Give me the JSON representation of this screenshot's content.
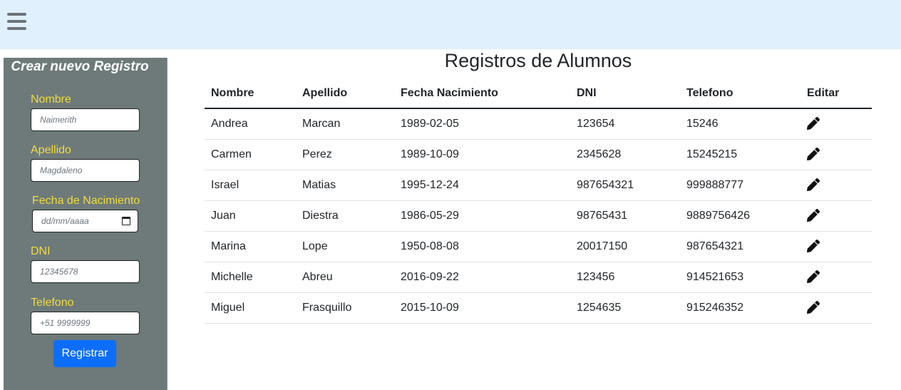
{
  "sidebar": {
    "title": "Crear nuevo Registro",
    "fields": {
      "nombre": {
        "label": "Nombre",
        "placeholder": "Naimerith"
      },
      "apellido": {
        "label": "Apellido",
        "placeholder": "Magdaleno"
      },
      "fecha": {
        "label": "Fecha de Nacimiento",
        "placeholder": "dd/mm/aaaa"
      },
      "dni": {
        "label": "DNI",
        "placeholder": "12345678"
      },
      "telefono": {
        "label": "Telefono",
        "placeholder": "+51 9999999"
      }
    },
    "submit_label": "Registrar"
  },
  "main": {
    "title": "Registros de Alumnos",
    "columns": [
      "Nombre",
      "Apellido",
      "Fecha Nacimiento",
      "DNI",
      "Telefono",
      "Editar"
    ],
    "rows": [
      [
        "Andrea",
        "Marcan",
        "1989-02-05",
        "123654",
        "15246"
      ],
      [
        "Carmen",
        "Perez",
        "1989-10-09",
        "2345628",
        "15245215"
      ],
      [
        "Israel",
        "Matias",
        "1995-12-24",
        "987654321",
        "999888777"
      ],
      [
        "Juan",
        "Diestra",
        "1986-05-29",
        "98765431",
        "9889756426"
      ],
      [
        "Marina",
        "Lope",
        "1950-08-08",
        "20017150",
        "987654321"
      ],
      [
        "Michelle",
        "Abreu",
        "2016-09-22",
        "123456",
        "914521653"
      ],
      [
        "Miguel",
        "Frasquillo",
        "2015-10-09",
        "1254635",
        "915246352"
      ]
    ]
  },
  "icons": {
    "menu": "hamburger-menu-icon",
    "edit": "pencil-icon",
    "date": "calendar-icon"
  },
  "colors": {
    "accent": "#0d6efd",
    "sidebar": "#6d7a79",
    "label": "#f3dc3c",
    "topbar": "#e1f0fd"
  }
}
